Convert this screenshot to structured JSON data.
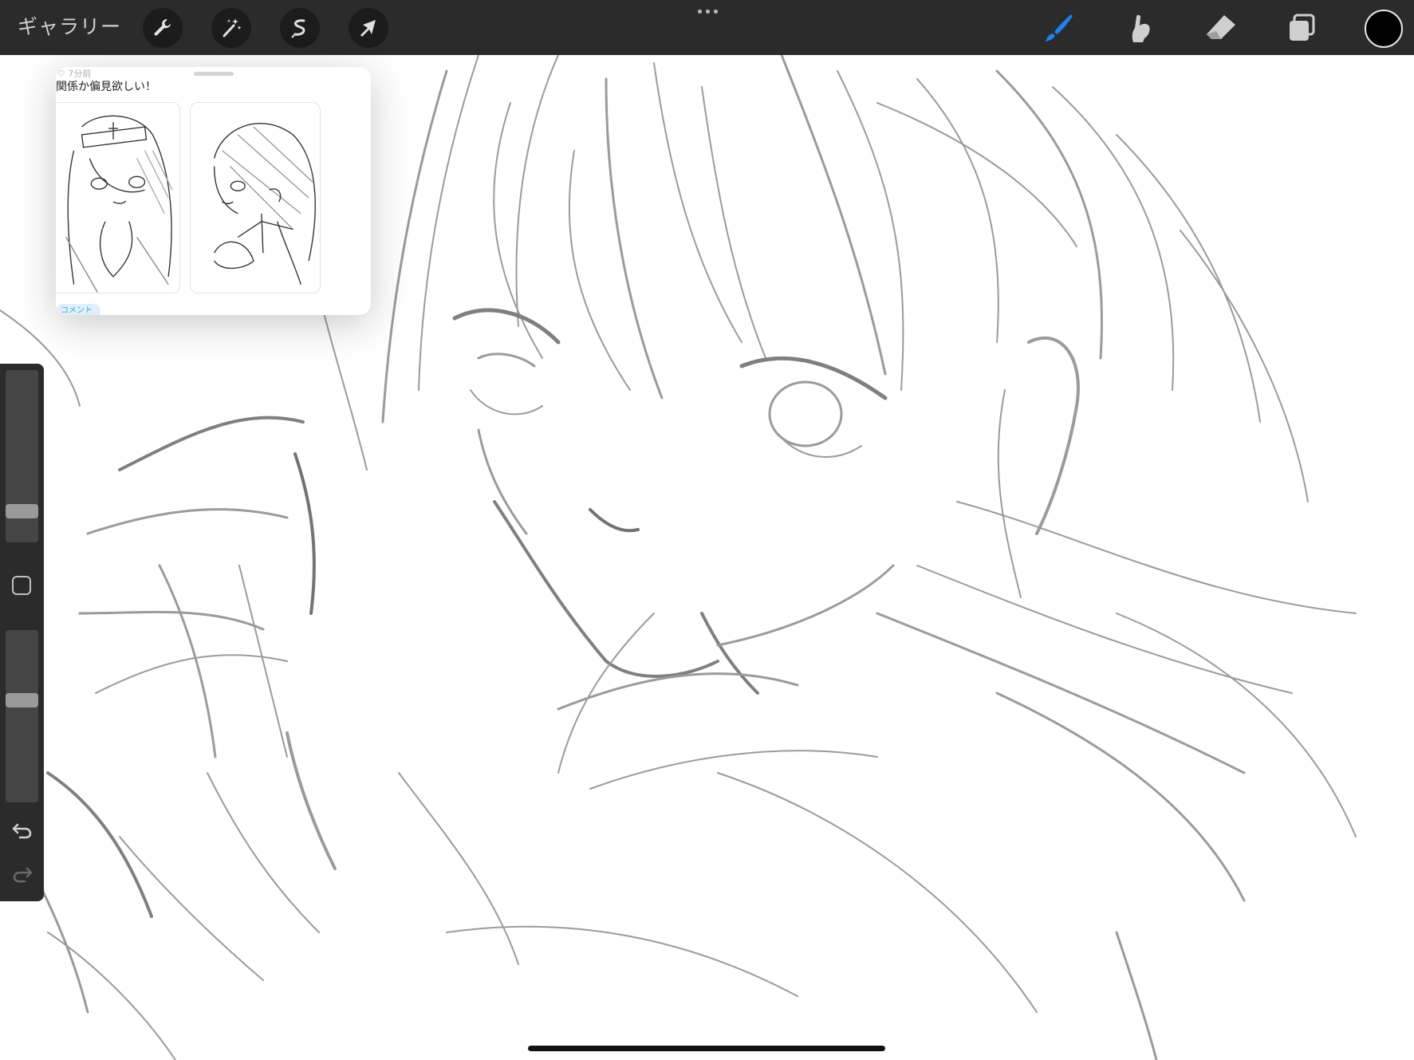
{
  "toolbar": {
    "gallery_label": "ギャラリー",
    "left_tools": [
      {
        "name": "actions",
        "icon": "wrench-icon"
      },
      {
        "name": "adjustments",
        "icon": "magic-wand-icon"
      },
      {
        "name": "selection",
        "icon": "selection-s-icon"
      },
      {
        "name": "transform",
        "icon": "arrow-cursor-icon"
      }
    ],
    "more_icon": "more-dots-icon",
    "right_tools": [
      {
        "name": "brush",
        "icon": "brush-icon",
        "active": true,
        "color": "#1e7ff0"
      },
      {
        "name": "smudge",
        "icon": "smudge-finger-icon",
        "active": false,
        "color": "#cfcfcf"
      },
      {
        "name": "eraser",
        "icon": "eraser-icon",
        "active": false,
        "color": "#cfcfcf"
      },
      {
        "name": "layers",
        "icon": "layers-icon",
        "active": false,
        "color": "#cfcfcf"
      }
    ],
    "current_color": "#000000"
  },
  "reference": {
    "time_text": "7分前",
    "caption": "関係か偏見欲しい！",
    "tag_text": "コメント"
  },
  "sidebar": {
    "brush_size": 0.15,
    "opacity": 0.6,
    "modify_icon": "square-modify-icon",
    "undo_icon": "undo-arrow-icon",
    "redo_icon": "redo-arrow-icon"
  }
}
